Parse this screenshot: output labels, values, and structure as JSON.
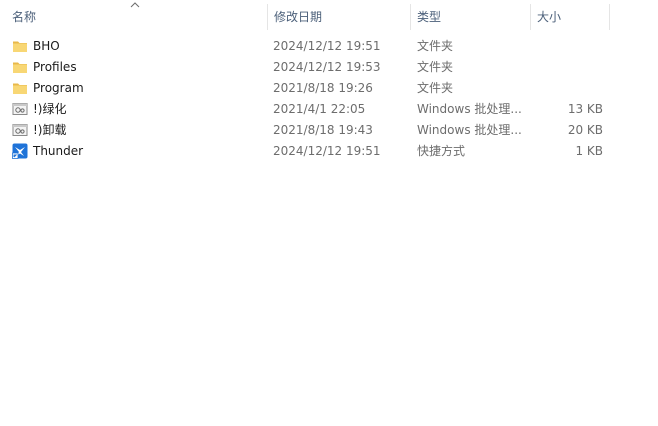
{
  "columns": {
    "name": "名称",
    "date": "修改日期",
    "type": "类型",
    "size": "大小"
  },
  "sort": {
    "column": "name",
    "direction": "ascending",
    "icon": "sort-up-chevron-icon"
  },
  "files": [
    {
      "name": "BHO",
      "date": "2024/12/12 19:51",
      "type": "文件夹",
      "size": "",
      "icon": "folder-icon"
    },
    {
      "name": "Profiles",
      "date": "2024/12/12 19:53",
      "type": "文件夹",
      "size": "",
      "icon": "folder-icon"
    },
    {
      "name": "Program",
      "date": "2021/8/18 19:26",
      "type": "文件夹",
      "size": "",
      "icon": "folder-icon"
    },
    {
      "name": "!)绿化",
      "date": "2021/4/1 22:05",
      "type": "Windows 批处理...",
      "size": "13 KB",
      "icon": "batch-file-icon"
    },
    {
      "name": "!)卸载",
      "date": "2021/8/18 19:43",
      "type": "Windows 批处理...",
      "size": "20 KB",
      "icon": "batch-file-icon"
    },
    {
      "name": "Thunder",
      "date": "2024/12/12 19:51",
      "type": "快捷方式",
      "size": "1 KB",
      "icon": "thunder-shortcut-icon"
    }
  ],
  "colors": {
    "header_text": "#4c607a",
    "folder_yellow": "#f8d775",
    "thunder_blue": "#1e73d8"
  }
}
